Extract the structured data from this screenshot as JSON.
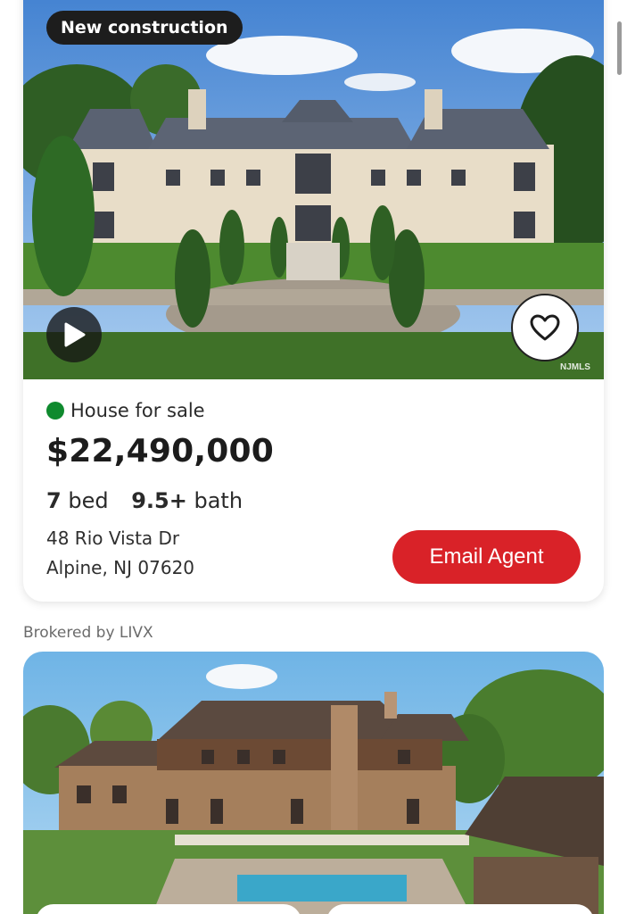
{
  "listing": {
    "badge": "New construction",
    "status": "House for sale",
    "status_color": "#0f8a2e",
    "price": "$22,490,000",
    "beds_value": "7",
    "beds_label": "bed",
    "baths_value": "9.5+",
    "baths_label": "bath",
    "address_line1": "48 Rio Vista Dr",
    "address_line2": "Alpine, NJ 07620",
    "email_button": "Email Agent",
    "accent_color": "#d92228",
    "watermark": "NJMLS",
    "icons": [
      "play-icon",
      "heart-icon"
    ]
  },
  "next_listing": {
    "brokered_by": "Brokered by LIVX"
  }
}
